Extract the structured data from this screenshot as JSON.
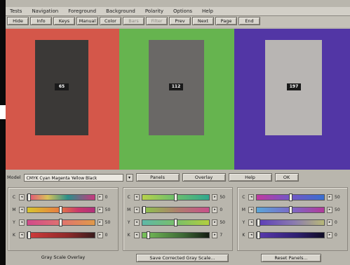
{
  "menu": [
    "Tests",
    "Navigation",
    "Foreground",
    "Background",
    "Polarity",
    "Options",
    "Help"
  ],
  "toolbar": [
    {
      "label": "Hide",
      "enabled": true
    },
    {
      "label": "Info",
      "enabled": true
    },
    {
      "label": "Keys",
      "enabled": true
    },
    {
      "label": "Manual",
      "enabled": true
    },
    {
      "label": "Color",
      "enabled": true
    },
    {
      "label": "Bars",
      "enabled": false
    },
    {
      "label": "Filter",
      "enabled": false
    },
    {
      "label": "Prev",
      "enabled": true
    },
    {
      "label": "Next",
      "enabled": true
    },
    {
      "label": "Page",
      "enabled": true
    },
    {
      "label": "End",
      "enabled": true
    }
  ],
  "panels": [
    {
      "background": "#d4574a",
      "swatch": "#3b3937",
      "value": "65"
    },
    {
      "background": "#66b44f",
      "swatch": "#6a6866",
      "value": "112"
    },
    {
      "background": "#5236a5",
      "swatch": "#b8b5b3",
      "value": "197"
    }
  ],
  "model": {
    "label": "Model",
    "selected": "CMYK  Cyan Magenta Yellow Black",
    "dropdown_glyph": "▾",
    "buttons": [
      "Panels",
      "Overlay",
      "Help",
      "OK"
    ]
  },
  "slider_groups": [
    {
      "rows": [
        {
          "channel": "C",
          "value": "0",
          "gradient": "linear-gradient(90deg,#e24a7a,#d9c25a 30%,#2a8f8a 60%,#c8397e)",
          "level": 0.0
        },
        {
          "channel": "M",
          "value": "50",
          "gradient": "linear-gradient(90deg,#d7c52d,#e7803f 45%,#c93a6b 75%,#b0307a)",
          "level": 0.5
        },
        {
          "channel": "Y",
          "value": "50",
          "gradient": "linear-gradient(90deg,#d14a8b,#e0736f 50%,#e09a4a)",
          "level": 0.5
        },
        {
          "channel": "K",
          "value": "0",
          "gradient": "linear-gradient(90deg,#d23c3c,#8e2a2a 60%,#3a1c1c)",
          "level": 0.0
        }
      ]
    },
    {
      "rows": [
        {
          "channel": "C",
          "value": "50",
          "gradient": "linear-gradient(90deg,#b7d24a,#72c06a 45%,#2fa88e)",
          "level": 0.5
        },
        {
          "channel": "M",
          "value": "0",
          "gradient": "linear-gradient(90deg,#8cc64a,#b07a6e 55%,#c8508a)",
          "level": 0.0
        },
        {
          "channel": "Y",
          "value": "50",
          "gradient": "linear-gradient(90deg,#5fb8a8,#79bf6a 50%,#b2cf3e)",
          "level": 0.5
        },
        {
          "channel": "K",
          "value": "7",
          "gradient": "linear-gradient(90deg,#78c25a,#3e6a36 60%,#141c12)",
          "level": 0.07
        }
      ]
    },
    {
      "rows": [
        {
          "channel": "C",
          "value": "50",
          "gradient": "linear-gradient(90deg,#c03aa0,#7a54c4 45%,#3a6fd0)",
          "level": 0.5
        },
        {
          "channel": "M",
          "value": "50",
          "gradient": "linear-gradient(90deg,#5aa6d8,#7a6ac8 50%,#b23a9a)",
          "level": 0.5
        },
        {
          "channel": "Y",
          "value": "0",
          "gradient": "linear-gradient(90deg,#5a3ab8,#8a7ab0 55%,#b8b878)",
          "level": 0.0
        },
        {
          "channel": "K",
          "value": "0",
          "gradient": "linear-gradient(90deg,#5a3ab0,#2e2070 60%,#100c24)",
          "level": 0.0
        }
      ]
    }
  ],
  "bottom": {
    "overlay_label": "Gray Scale Overlay",
    "gray_scale_button": "Save Corrected Gray Scale...",
    "reset_button": "Reset Panels..."
  }
}
